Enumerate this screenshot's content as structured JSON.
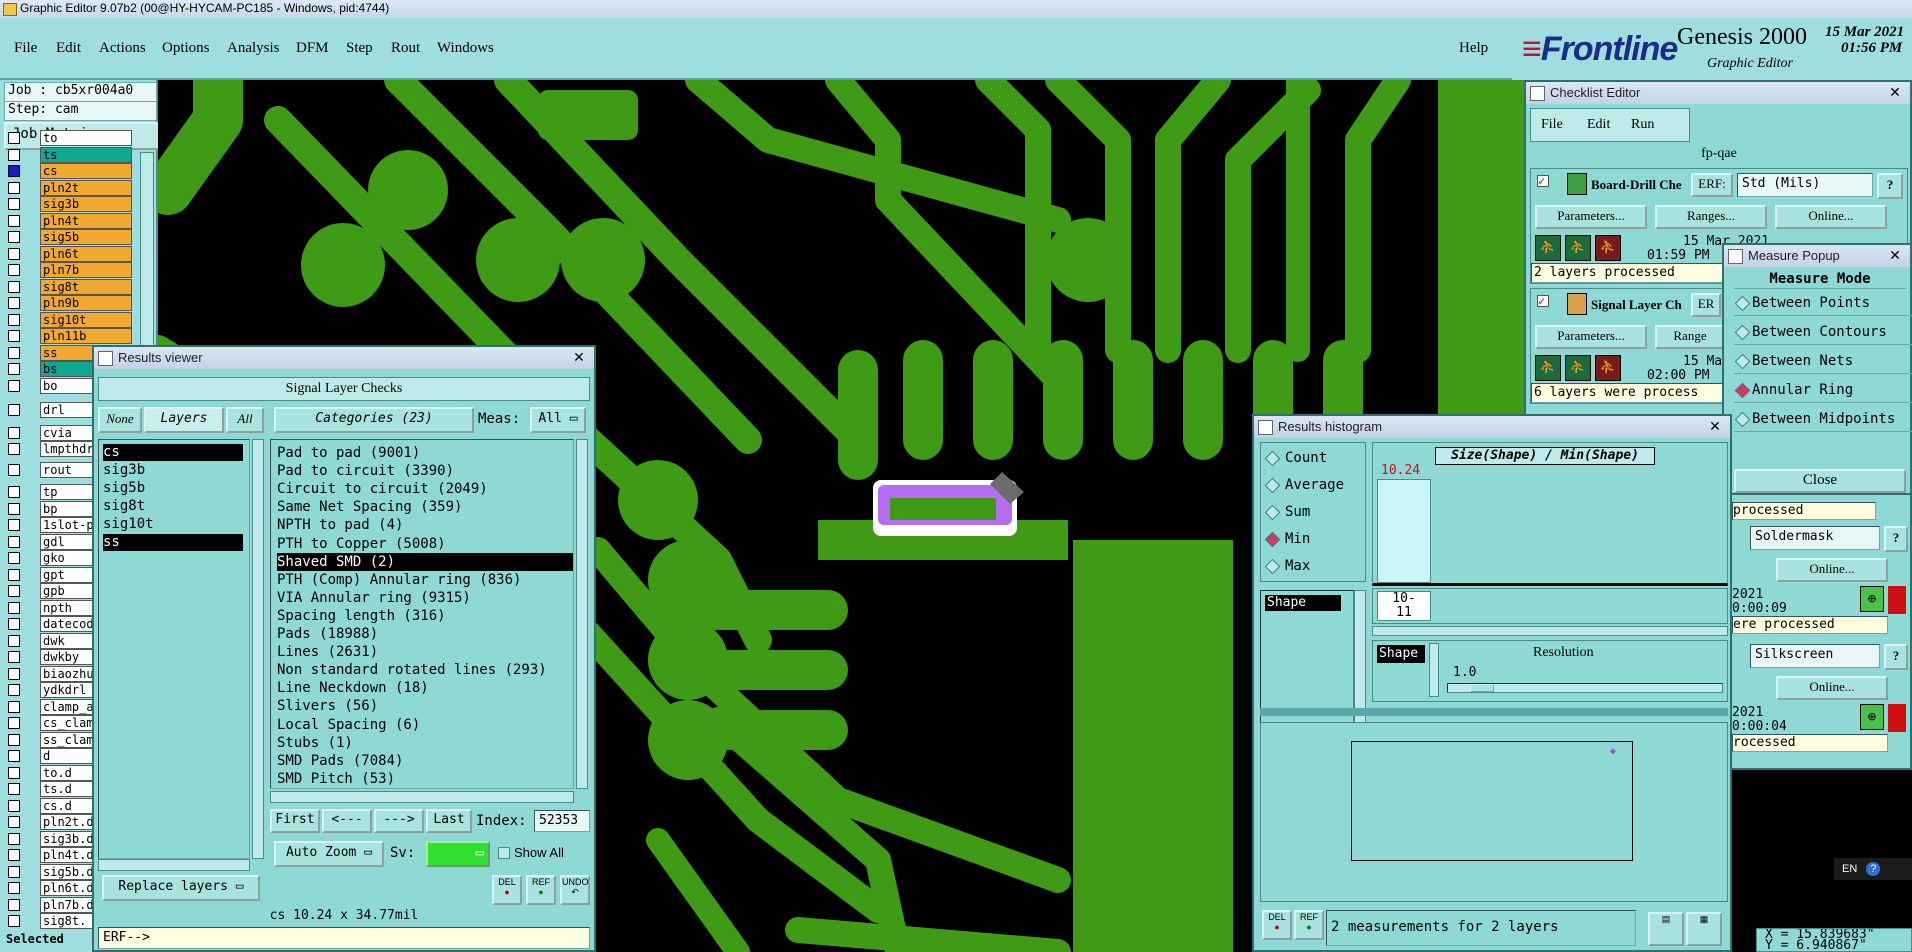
{
  "window_title": "Graphic Editor 9.07b2 (00@HY-HYCAM-PC185 - Windows, pid:4744)",
  "menu": [
    "File",
    "Edit",
    "Actions",
    "Options",
    "Analysis",
    "DFM",
    "Step",
    "Rout",
    "Windows"
  ],
  "help": "Help",
  "brand": {
    "logo": "Frontline",
    "product": "Genesis 2000",
    "subtitle": "Graphic Editor",
    "date": "15 Mar 2021",
    "time": "01:56 PM"
  },
  "left": {
    "job": "Job : cb5xr004a0",
    "step": "Step: cam",
    "job_matrix": "Job Matrix ...",
    "layers": [
      {
        "name": "to",
        "color": "#ffffff"
      },
      {
        "name": "ts",
        "color": "#10a890"
      },
      {
        "name": "cs",
        "color": "#f0a830",
        "selected": true
      },
      {
        "name": "pln2t",
        "color": "#f0a830"
      },
      {
        "name": "sig3b",
        "color": "#f0a830"
      },
      {
        "name": "pln4t",
        "color": "#f0a830"
      },
      {
        "name": "sig5b",
        "color": "#f0a830"
      },
      {
        "name": "pln6t",
        "color": "#f0a830"
      },
      {
        "name": "pln7b",
        "color": "#f0a830"
      },
      {
        "name": "sig8t",
        "color": "#f0a830"
      },
      {
        "name": "pln9b",
        "color": "#f0a830"
      },
      {
        "name": "sig10t",
        "color": "#f0a830"
      },
      {
        "name": "pln11b",
        "color": "#f0a830"
      },
      {
        "name": "ss",
        "color": "#f0a830"
      },
      {
        "name": "bs",
        "color": "#10a890"
      },
      {
        "name": "bo",
        "color": "#ffffff"
      }
    ],
    "drill_layers": [
      "drl"
    ],
    "layers2": [
      "cvia",
      "lmpthdr"
    ],
    "rout_layers": [
      "rout"
    ],
    "misc_layers": [
      "tp",
      "bp",
      "1slot-p",
      "gdl",
      "gko",
      "gpt",
      "gpb",
      "npth",
      "datecod",
      "dwk",
      "dwkby",
      "biaozhu",
      "ydkdrl",
      "clamp_a",
      "cs_clam",
      "ss_clam",
      "d",
      "to.d",
      "ts.d",
      "cs.d",
      "pln2t.d",
      "sig3b.d",
      "pln4t.d",
      "sig5b.d",
      "pln6t.d",
      "pln7b.d",
      "sig8t."
    ],
    "selected_label": "Selected"
  },
  "results_viewer": {
    "title": "Results viewer",
    "header": "Signal Layer Checks",
    "btn_none": "None",
    "btn_layers": "Layers",
    "btn_all": "All",
    "categories_label": "Categories (23)",
    "meas_label": "Meas:",
    "meas_value": "All",
    "layers": [
      {
        "name": "cs",
        "selected": true
      },
      {
        "name": "sig3b"
      },
      {
        "name": "sig5b"
      },
      {
        "name": "sig8t"
      },
      {
        "name": "sig10t"
      },
      {
        "name": "ss",
        "selected": true
      }
    ],
    "categories": [
      {
        "text": "Pad to pad (9001)"
      },
      {
        "text": "Pad to circuit (3390)"
      },
      {
        "text": "Circuit to circuit (2049)"
      },
      {
        "text": "Same Net Spacing (359)"
      },
      {
        "text": "NPTH to pad (4)"
      },
      {
        "text": "PTH to Copper (5008)"
      },
      {
        "text": "Shaved SMD (2)",
        "selected": true
      },
      {
        "text": "PTH (Comp) Annular ring (836)"
      },
      {
        "text": "VIA Annular ring (9315)"
      },
      {
        "text": "Spacing length (316)"
      },
      {
        "text": "Pads (18988)"
      },
      {
        "text": "Lines (2631)"
      },
      {
        "text": "Non standard rotated lines (293)"
      },
      {
        "text": "Line Neckdown (18)"
      },
      {
        "text": "Slivers (56)"
      },
      {
        "text": "Local Spacing (6)"
      },
      {
        "text": "Stubs (1)"
      },
      {
        "text": "SMD Pads (7084)"
      },
      {
        "text": "SMD Pitch (53)"
      }
    ],
    "nav_first": "First",
    "nav_prev": "<---",
    "nav_next": "--->",
    "nav_last": "Last",
    "index_label": "Index:",
    "index_value": "52353",
    "auto_zoom": "Auto Zoom",
    "sv_label": "Sv:",
    "show_all": "Show All",
    "replace_layers": "Replace layers",
    "icon_del": "DEL",
    "icon_ref": "REF",
    "icon_undo": "UNDO",
    "status": "cs 10.24 x 34.77mil",
    "erf": "ERF-->"
  },
  "checklist": {
    "title": "Checklist Editor",
    "menu": [
      "File",
      "Edit",
      "Run"
    ],
    "name": "fp-qae",
    "items": [
      {
        "name": "Board-Drill Che",
        "erf_label": "ERF:",
        "erf_value": "Std (Mils)",
        "help": "?",
        "params": "Parameters...",
        "ranges": "Ranges...",
        "online": "Online...",
        "date": "15 Mar 2021",
        "time": "01:59 PM",
        "status": "2 layers processed"
      },
      {
        "name": "Signal Layer Ch",
        "erf_label": "ER",
        "params": "Parameters...",
        "ranges": "Range",
        "date": "15 Mar",
        "time": "02:00 PM",
        "status": "6 layers were process"
      }
    ],
    "right_items": [
      {
        "status_prev": "processed",
        "erf_value": "Soldermask",
        "help": "?",
        "online": "Online...",
        "date": "2021",
        "time": "0:00:09",
        "status": "ere processed"
      },
      {
        "erf_value": "Silkscreen",
        "help": "?",
        "online": "Online...",
        "date": "2021",
        "time": "0:00:04",
        "status": "rocessed"
      }
    ],
    "tail": "e"
  },
  "measure": {
    "title": "Measure Popup",
    "header": "Measure Mode",
    "modes": [
      {
        "label": "Between Points"
      },
      {
        "label": "Between Contours"
      },
      {
        "label": "Between Nets"
      },
      {
        "label": "Annular Ring",
        "active": true
      },
      {
        "label": "Between Midpoints"
      }
    ],
    "close": "Close"
  },
  "histogram": {
    "title": "Results histogram",
    "options": [
      {
        "label": "Count"
      },
      {
        "label": "Average"
      },
      {
        "label": "Sum"
      },
      {
        "label": "Min",
        "active": true
      },
      {
        "label": "Max"
      }
    ],
    "list_item": "Shape",
    "chart_title": "Size(Shape) / Min(Shape)",
    "bar_value": "10.24",
    "bar_range_1": "10-",
    "bar_range_2": "11",
    "shape_label": "Shape",
    "resolution_label": "Resolution",
    "resolution_value": "1.0",
    "status": "2 measurements for 2 layers",
    "icon_del": "DEL",
    "icon_ref": "REF"
  },
  "tray": {
    "lang": "EN",
    "help": "?",
    "coord_x": "X = 15.839683\"",
    "coord_y": "Y = 6.940867\""
  },
  "colors": {
    "copper": "#3f9a16",
    "ui_bg": "#8ed9d3",
    "highlight": "#b56ef2"
  }
}
